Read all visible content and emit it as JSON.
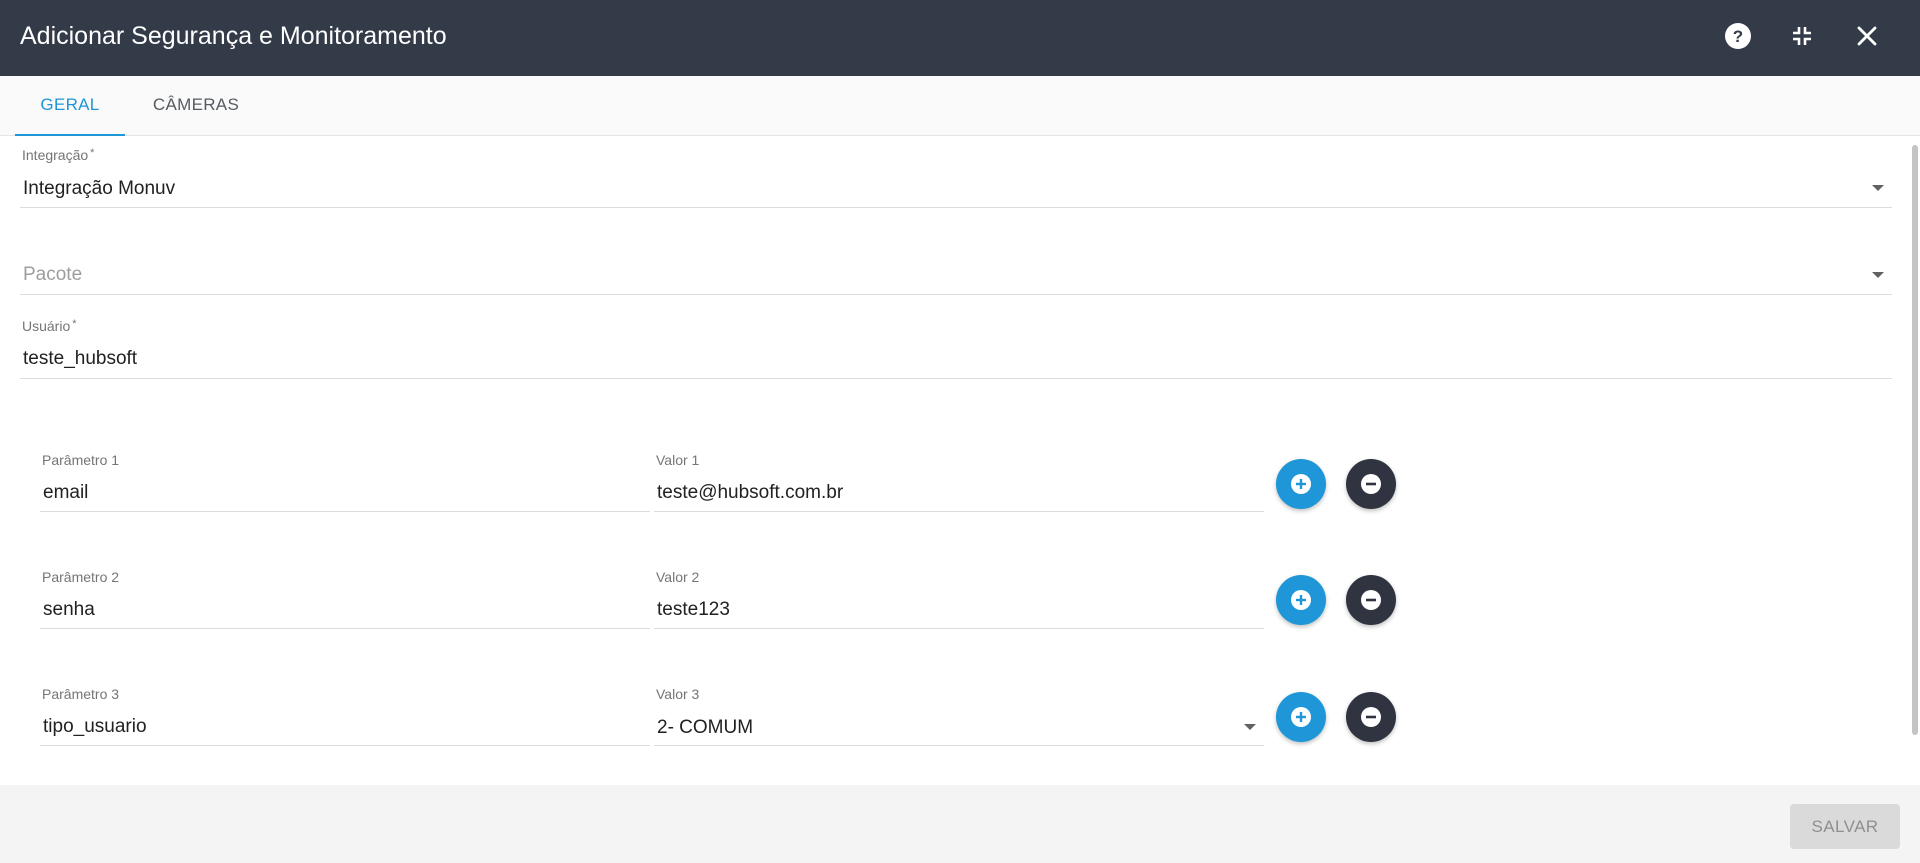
{
  "window": {
    "title": "Adicionar Segurança e Monitoramento"
  },
  "icons": {
    "help": "help-circle-icon",
    "minimize": "fullscreen-exit-icon",
    "close": "close-icon",
    "add": "plus-circle-icon",
    "remove": "minus-circle-icon",
    "dropdown": "triangle-down-icon"
  },
  "colors": {
    "titlebar": "#333a48",
    "accent": "#1e96d7",
    "remove_button": "#2f3440"
  },
  "tabs": [
    {
      "label": "GERAL",
      "active": true
    },
    {
      "label": "CÂMERAS",
      "active": false
    }
  ],
  "form": {
    "integracao": {
      "label": "Integração",
      "required_mark": "*",
      "value": "Integração Monuv"
    },
    "pacote": {
      "placeholder": "Pacote",
      "value": ""
    },
    "usuario": {
      "label": "Usuário",
      "required_mark": "*",
      "value": "teste_hubsoft"
    }
  },
  "parameters": [
    {
      "param_label": "Parâmetro 1",
      "param_value": "email",
      "valor_label": "Valor 1",
      "valor_value": "teste@hubsoft.com.br",
      "valor_is_select": false
    },
    {
      "param_label": "Parâmetro 2",
      "param_value": "senha",
      "valor_label": "Valor 2",
      "valor_value": "teste123",
      "valor_is_select": false
    },
    {
      "param_label": "Parâmetro 3",
      "param_value": "tipo_usuario",
      "valor_label": "Valor 3",
      "valor_value": "2- COMUM",
      "valor_is_select": true
    }
  ],
  "footer": {
    "save_label": "SALVAR"
  }
}
